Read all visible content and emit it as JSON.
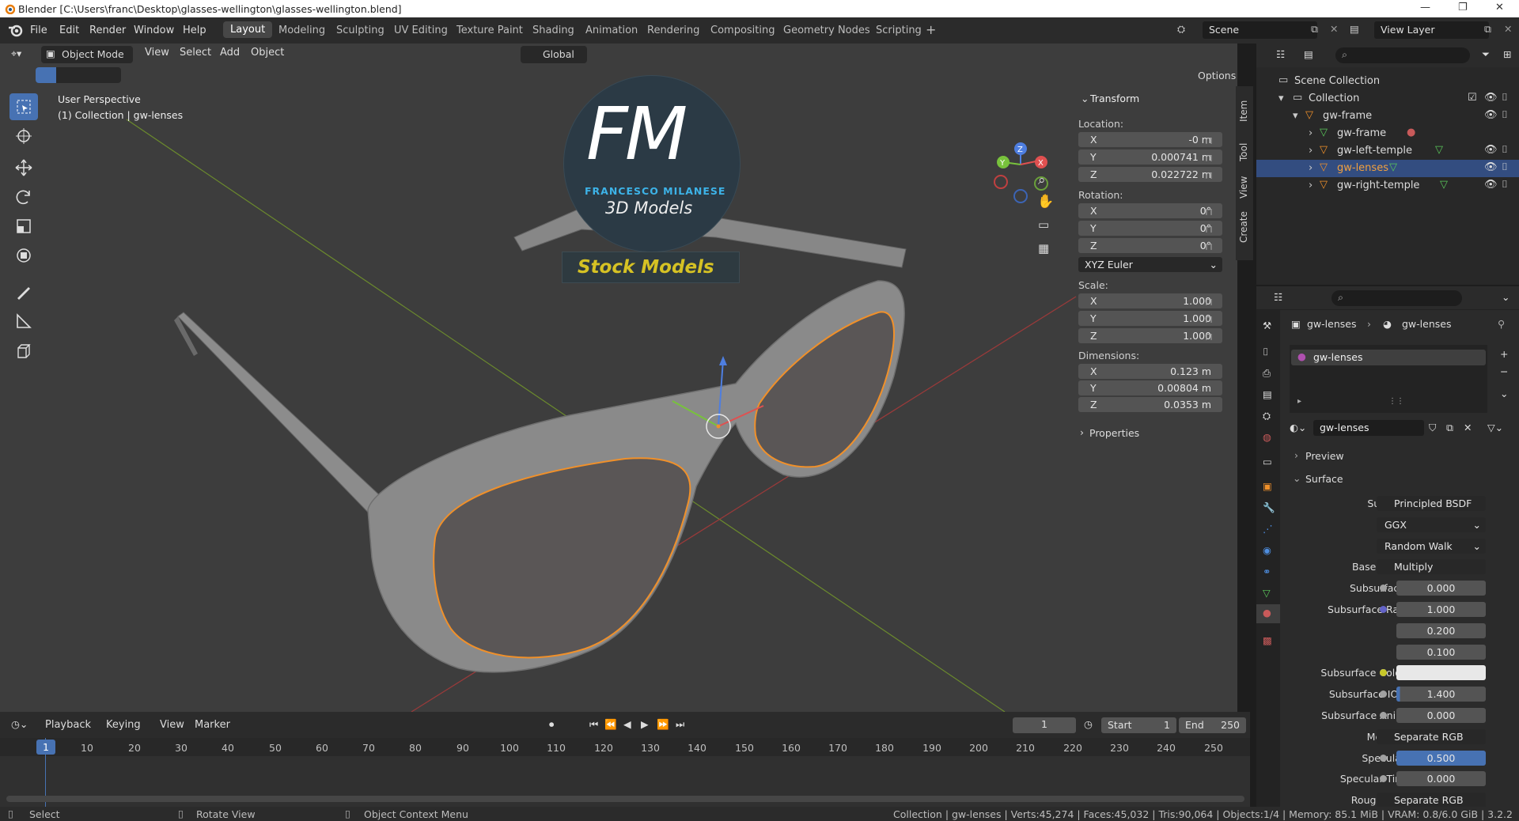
{
  "window": {
    "title": "Blender [C:\\Users\\franc\\Desktop\\glasses-wellington\\glasses-wellington.blend]"
  },
  "menu": [
    "File",
    "Edit",
    "Render",
    "Window",
    "Help"
  ],
  "workspaces": [
    "Layout",
    "Modeling",
    "Sculpting",
    "UV Editing",
    "Texture Paint",
    "Shading",
    "Animation",
    "Rendering",
    "Compositing",
    "Geometry Nodes",
    "Scripting"
  ],
  "scene": {
    "name": "Scene",
    "view_layer": "View Layer"
  },
  "viewport_header": {
    "mode": "Object Mode",
    "view": "View",
    "select": "Select",
    "add": "Add",
    "object": "Object",
    "orientation": "Global",
    "options": "Options"
  },
  "viewport": {
    "perspective": "User Perspective",
    "collection_info": "(1) Collection | gw-lenses"
  },
  "watermark": {
    "logo": "FM",
    "author": "FRANCESCO MILANESE",
    "sub": "3D Models",
    "banner": "Stock Models"
  },
  "transform": {
    "title": "Transform",
    "location_label": "Location:",
    "location": [
      {
        "axis": "X",
        "value": "-0 m"
      },
      {
        "axis": "Y",
        "value": "0.000741 m"
      },
      {
        "axis": "Z",
        "value": "0.022722 m"
      }
    ],
    "rotation_label": "Rotation:",
    "rotation": [
      {
        "axis": "X",
        "value": "0°"
      },
      {
        "axis": "Y",
        "value": "0°"
      },
      {
        "axis": "Z",
        "value": "0°"
      }
    ],
    "rotation_mode": "XYZ Euler",
    "scale_label": "Scale:",
    "scale": [
      {
        "axis": "X",
        "value": "1.000"
      },
      {
        "axis": "Y",
        "value": "1.000"
      },
      {
        "axis": "Z",
        "value": "1.000"
      }
    ],
    "dimensions_label": "Dimensions:",
    "dimensions": [
      {
        "axis": "X",
        "value": "0.123 m"
      },
      {
        "axis": "Y",
        "value": "0.00804 m"
      },
      {
        "axis": "Z",
        "value": "0.0353 m"
      }
    ],
    "properties": "Properties"
  },
  "side_tabs": [
    "Item",
    "Tool",
    "View",
    "Create"
  ],
  "outliner": {
    "scene_collection": "Scene Collection",
    "collection": "Collection",
    "items": [
      "gw-frame",
      "gw-frame",
      "gw-left-temple",
      "gw-lenses",
      "gw-right-temple"
    ]
  },
  "properties": {
    "breadcrumb_object": "gw-lenses",
    "breadcrumb_material": "gw-lenses",
    "slot": "gw-lenses",
    "material_name": "gw-lenses",
    "preview": "Preview",
    "surface_section": "Surface",
    "rows": [
      {
        "label": "Surface",
        "value": "Principled BSDF",
        "kind": "node",
        "dot": "#63c763"
      },
      {
        "label": "",
        "value": "GGX",
        "kind": "dropdown"
      },
      {
        "label": "",
        "value": "Random Walk",
        "kind": "dropdown"
      },
      {
        "label": "Base Color",
        "value": "Multiply",
        "kind": "node",
        "dot": "#c7c729"
      },
      {
        "label": "Subsurface",
        "value": "0.000",
        "kind": "num",
        "dot": "#a1a1a1"
      },
      {
        "label": "Subsurface Rad",
        "value": "1.000",
        "kind": "num",
        "dot": "#6363c7"
      },
      {
        "label": "",
        "value": "0.200",
        "kind": "num"
      },
      {
        "label": "",
        "value": "0.100",
        "kind": "num"
      },
      {
        "label": "Subsurface Color",
        "value": "",
        "kind": "color",
        "dot": "#c7c729"
      },
      {
        "label": "Subsurface IOR",
        "value": "1.400",
        "kind": "num",
        "dot": "#a1a1a1"
      },
      {
        "label": "Subsurface Ani...",
        "value": "0.000",
        "kind": "num",
        "dot": "#a1a1a1"
      },
      {
        "label": "Metallic",
        "value": "Separate RGB",
        "kind": "node",
        "dot": "#a1a1a1"
      },
      {
        "label": "Specular",
        "value": "0.500",
        "kind": "num",
        "dot": "#a1a1a1"
      },
      {
        "label": "Specular Tint",
        "value": "0.000",
        "kind": "num",
        "dot": "#a1a1a1"
      },
      {
        "label": "Roughness",
        "value": "Separate RGB",
        "kind": "node",
        "dot": "#a1a1a1"
      }
    ],
    "subsurface_ior_fill": 0.04,
    "specular_fill": 1.0
  },
  "timeline": {
    "menus": [
      "Playback",
      "Keying",
      "View",
      "Marker"
    ],
    "current_frame": "1",
    "start_label": "Start",
    "start": "1",
    "end_label": "End",
    "end": "250",
    "ticks": [
      "1",
      "10",
      "20",
      "30",
      "40",
      "50",
      "60",
      "70",
      "80",
      "90",
      "100",
      "110",
      "120",
      "130",
      "140",
      "150",
      "160",
      "170",
      "180",
      "190",
      "200",
      "210",
      "220",
      "230",
      "240",
      "250"
    ]
  },
  "status": {
    "select": "Select",
    "rotate": "Rotate View",
    "context": "Object Context Menu",
    "stats": "Collection | gw-lenses | Verts:45,274 | Faces:45,032 | Tris:90,064 | Objects:1/4 | Memory: 85.1 MiB | VRAM: 0.8/6.0 GiB | 3.2.2"
  }
}
